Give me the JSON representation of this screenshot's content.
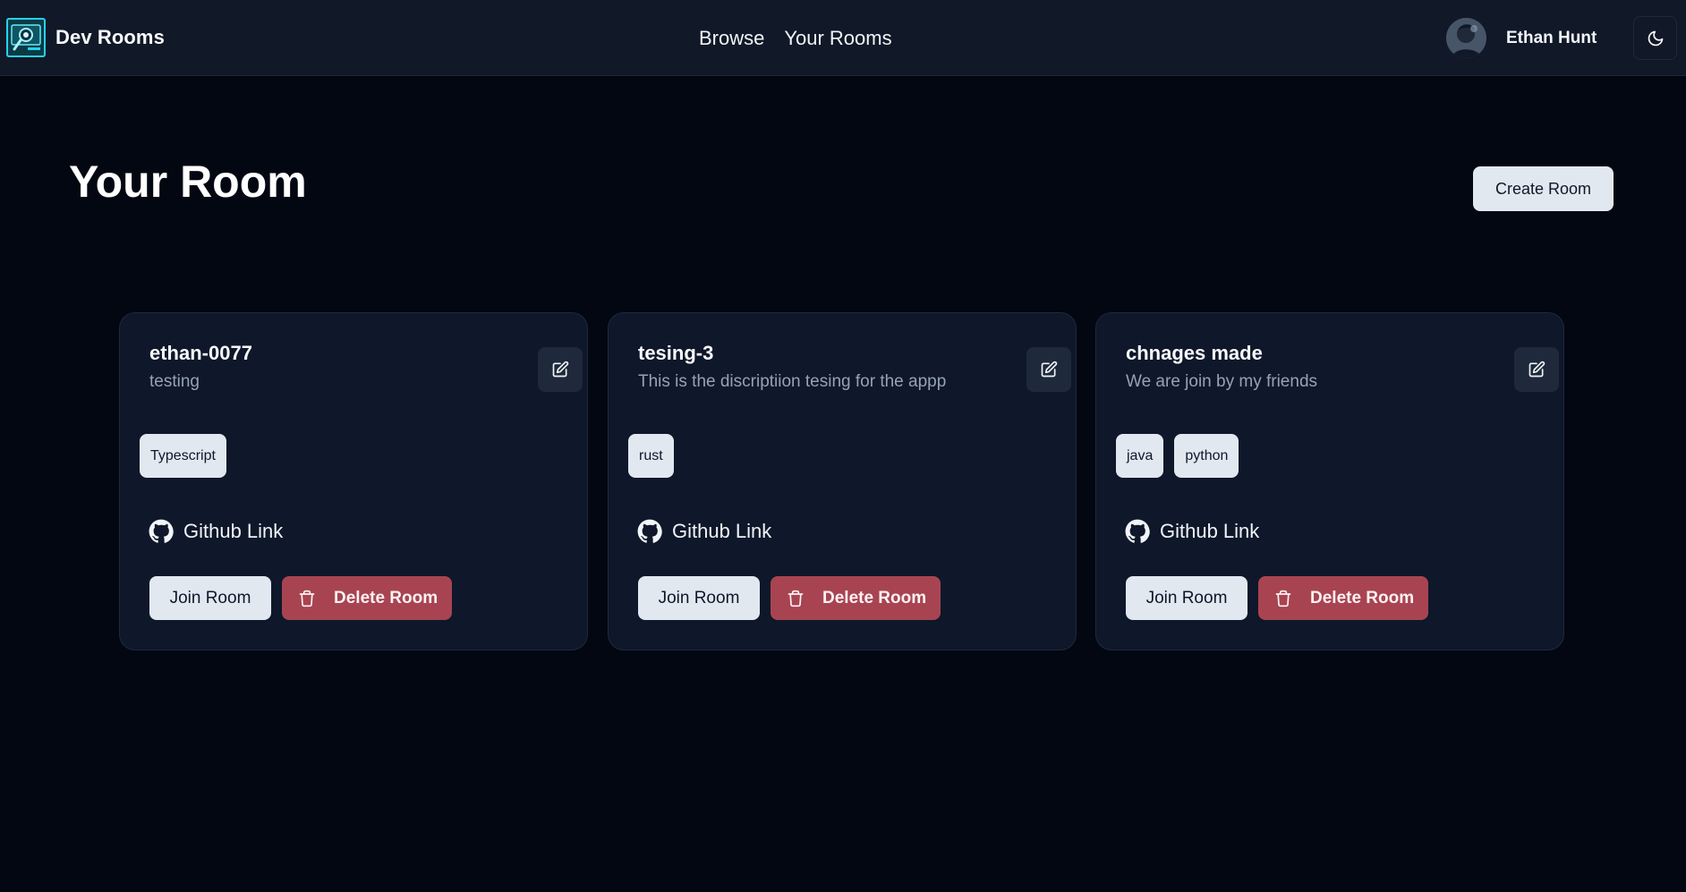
{
  "header": {
    "brand": "Dev Rooms",
    "nav": [
      "Browse",
      "Your Rooms"
    ],
    "user_name": "Ethan Hunt",
    "theme_icon": "moon-icon"
  },
  "page": {
    "title": "Your Room",
    "create_button": "Create Room"
  },
  "rooms": [
    {
      "name": "ethan-0077",
      "description": "testing",
      "tags": [
        "Typescript"
      ],
      "github_label": "Github Link",
      "join_label": "Join Room",
      "delete_label": "Delete Room"
    },
    {
      "name": "tesing-3",
      "description": "This is the discriptiion tesing for the appp",
      "tags": [
        "rust"
      ],
      "github_label": "Github Link",
      "join_label": "Join Room",
      "delete_label": "Delete Room"
    },
    {
      "name": "chnages made",
      "description": "We are join by my friends",
      "tags": [
        "java",
        "python"
      ],
      "github_label": "Github Link",
      "join_label": "Join Room",
      "delete_label": "Delete Room"
    }
  ],
  "colors": {
    "background": "#030712",
    "header": "#111827",
    "card": "#0f172a",
    "accent_danger": "#a84451",
    "button_light": "#e2e8f0",
    "logo_accent": "#22d3ee"
  }
}
